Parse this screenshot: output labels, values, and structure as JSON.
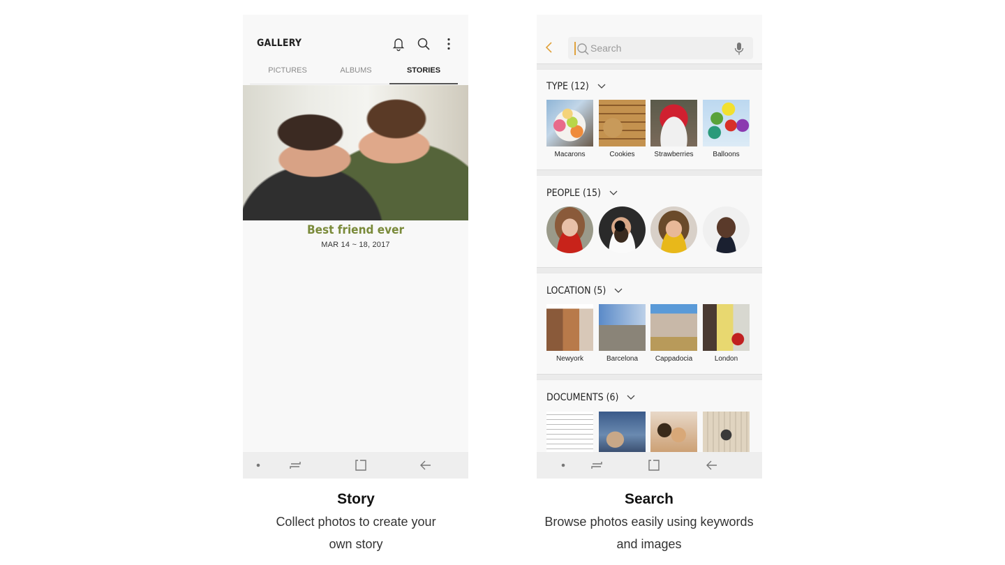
{
  "story_screen": {
    "app_title": "GALLERY",
    "icons": [
      "bell-icon",
      "search-icon",
      "more-vert-icon"
    ],
    "tabs": [
      {
        "label": "PICTURES",
        "active": false
      },
      {
        "label": "ALBUMS",
        "active": false
      },
      {
        "label": "STORIES",
        "active": true
      }
    ],
    "story": {
      "title": "Best friend ever",
      "date": "MAR 14 ~ 18, 2017",
      "title_color": "#7a8a3a"
    }
  },
  "search_screen": {
    "search": {
      "placeholder": "Search",
      "value": ""
    },
    "sections": [
      {
        "title": "TYPE (12)",
        "items": [
          "Macarons",
          "Cookies",
          "Strawberries",
          "Balloons"
        ]
      },
      {
        "title": "PEOPLE (15)",
        "items": []
      },
      {
        "title": "LOCATION (5)",
        "items": [
          "Newyork",
          "Barcelona",
          "Cappadocia",
          "London"
        ]
      },
      {
        "title": "DOCUMENTS (6)",
        "items": []
      }
    ],
    "accent_color": "#e0a23c"
  },
  "navbar": {
    "icons": [
      "dot-icon",
      "recent-apps-icon",
      "home-icon",
      "back-icon"
    ]
  },
  "captions": {
    "story": {
      "title": "Story",
      "line1": "Collect photos to create your",
      "line2": "own story"
    },
    "search": {
      "title": "Search",
      "line1": "Browse photos easily using keywords",
      "line2": "and images"
    }
  }
}
